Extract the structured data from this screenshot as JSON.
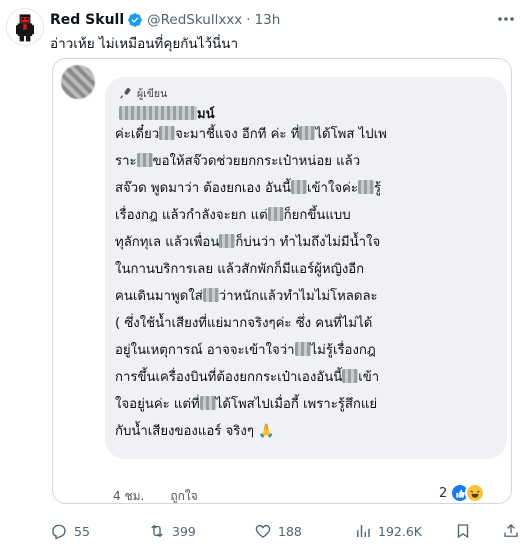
{
  "author": {
    "display_name": "Red Skull",
    "handle": "@RedSkullxxx",
    "separator": "·",
    "time": "13h"
  },
  "tweet_text": "อ่าวเห้ย ไม่เหมือนที่คุยกันไว้นี่นา",
  "screenshot": {
    "author_badge": "ผู้เขียน",
    "commenter_suffix": "มน์",
    "comment_lines": [
      [
        "ค่ะเดี๋ยว",
        "จะมาชี้แจง อีกที ค่ะ ที่",
        "ได้โพส ไปเพ"
      ],
      [
        "ราะ",
        "ขอให้สจ๊วดช่วยยกกระเป๋าหน่อย แล้ว"
      ],
      [
        "สจ๊วด พูดมาว่า ต้องยกเอง อันนี้",
        "เข้าใจค่ะ",
        "รู้"
      ],
      [
        "เรื่องกฎ แล้วกำลังจะยก แต่",
        "ก็ยกขึ้นแบบ"
      ],
      [
        "ทุลักทุเล แล้วเพื่อน",
        "ก็บ่นว่า ทำไมถึงไม่มีน้ำใจ"
      ],
      [
        "ในกานบริการเลย แล้วสักพักก็มีแอร์ผู้หญิงอีก"
      ],
      [
        "คนเดินมาพูดใส่",
        "ว่าหนักแล้วทำไมไม่โหลดละ"
      ],
      [
        "( ซึ่งใช้น้ำเสียงที่แย่มากจริงๆค่ะ ซึ่ง คนที่ไม่ได้"
      ],
      [
        "อยู่ในเหตุการณ์ อาจจะเข้าใจว่า",
        "ไม่รู้เรื่องกฎ"
      ],
      [
        "การขึ้นเครื่องบินที่ต้องยกกระเป๋าเองอันนี้",
        "เข้า"
      ],
      [
        "ใจอยู่นค่ะ แต่ที่",
        "ได้โพสไปเมื่อกี้ เพราะรู้สึกแย่"
      ],
      [
        "กับน้ำเสียงของแอร์ จริงๆ 🙏"
      ]
    ],
    "time_ago": "4 ชม.",
    "like_label": "ถูกใจ",
    "reaction_count": "2"
  },
  "actions": {
    "replies": "55",
    "retweets": "399",
    "likes": "188",
    "views": "192.6K"
  },
  "colors": {
    "verified": "#1d9bf0",
    "bubble": "#eff1f4",
    "muted": "#536471",
    "like_blue": "#1877f2",
    "haha_yellow": "#f7c23c"
  }
}
